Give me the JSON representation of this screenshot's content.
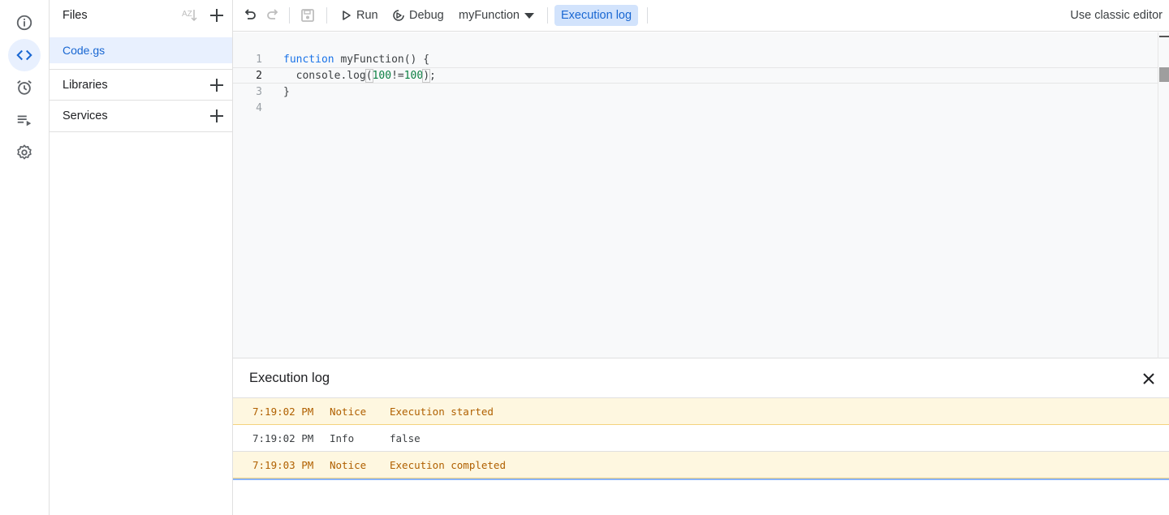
{
  "rail": {
    "items": [
      {
        "name": "overview",
        "icon": "info-icon"
      },
      {
        "name": "editor",
        "icon": "code-icon",
        "active": true
      },
      {
        "name": "triggers",
        "icon": "alarm-icon"
      },
      {
        "name": "executions",
        "icon": "playlist-play-icon"
      },
      {
        "name": "settings",
        "icon": "gear-icon"
      }
    ]
  },
  "files": {
    "title": "Files",
    "sort_label": "AZ",
    "items": [
      {
        "name": "Code.gs",
        "selected": true
      }
    ],
    "sections": [
      {
        "label": "Libraries"
      },
      {
        "label": "Services"
      }
    ]
  },
  "toolbar": {
    "run_label": "Run",
    "debug_label": "Debug",
    "function_selected": "myFunction",
    "execution_log_label": "Execution log",
    "classic_label": "Use classic editor"
  },
  "editor": {
    "current_line": 2,
    "lines": [
      {
        "number": "1",
        "text": "function myFunction() {"
      },
      {
        "number": "2",
        "text": "  console.log(100!=100);"
      },
      {
        "number": "3",
        "text": "}"
      },
      {
        "number": "4",
        "text": ""
      }
    ]
  },
  "log": {
    "title": "Execution log",
    "entries": [
      {
        "time": "7:19:02 PM",
        "level": "Notice",
        "message": "Execution started"
      },
      {
        "time": "7:19:02 PM",
        "level": "Info",
        "message": "false"
      },
      {
        "time": "7:19:03 PM",
        "level": "Notice",
        "message": "Execution completed"
      }
    ]
  },
  "colors": {
    "accent": "#1a73e8",
    "active_bg": "#e8f0fe",
    "notice_bg": "#fef7e0",
    "notice_text": "#b06000"
  }
}
